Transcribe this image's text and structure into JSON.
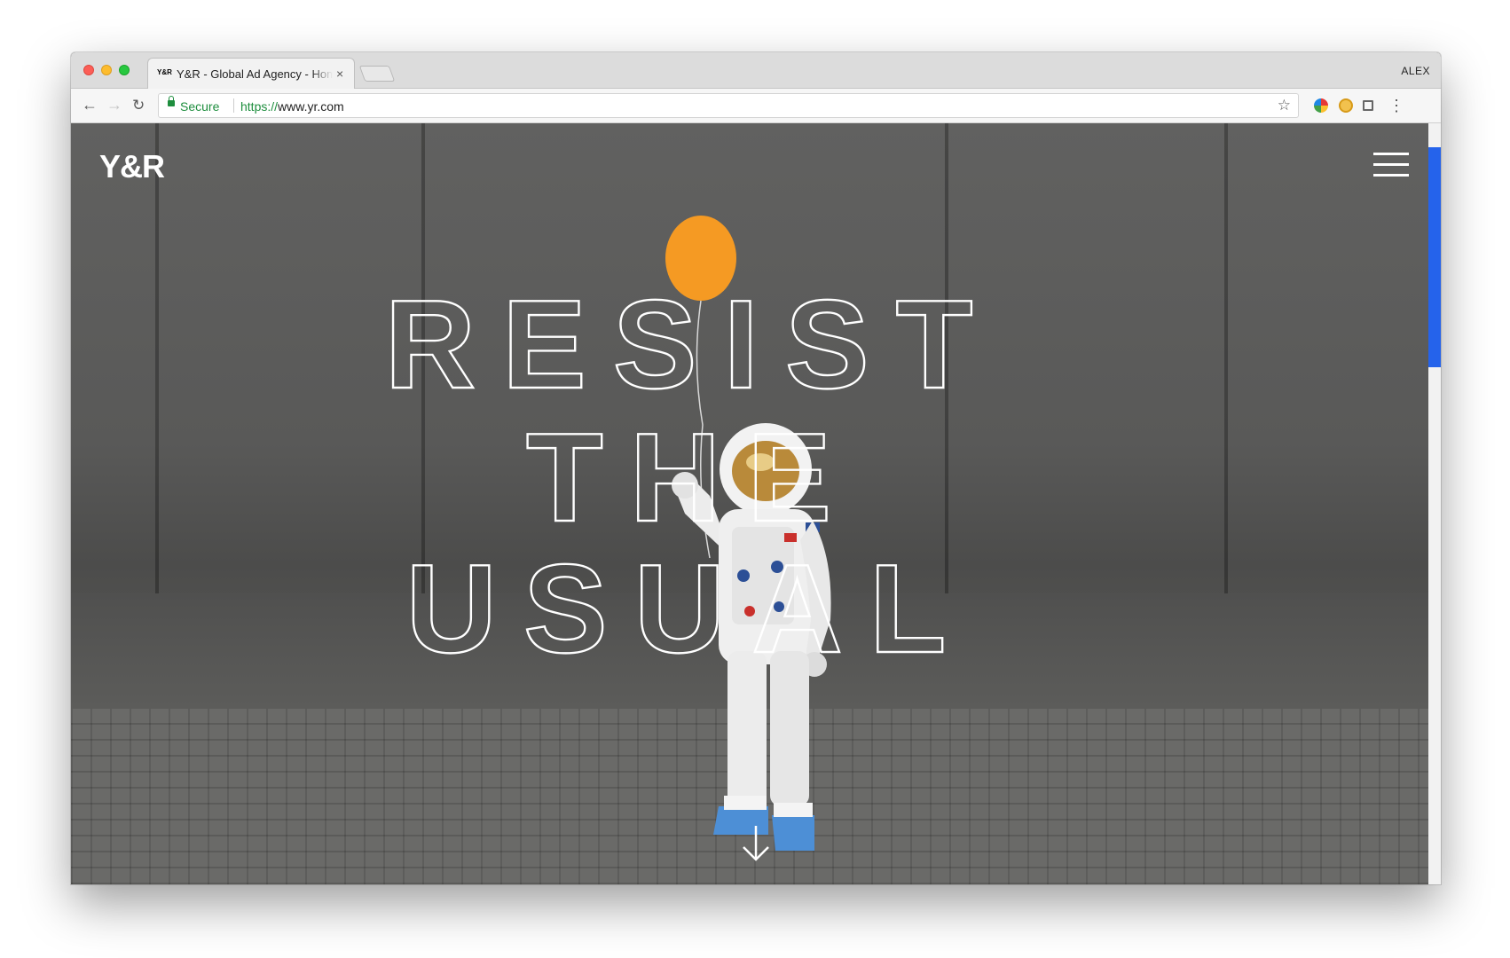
{
  "browser": {
    "tab": {
      "favicon_text": "Y&R",
      "title": "Y&R - Global Ad Agency - Home",
      "close_symbol": "×"
    },
    "profile_name": "ALEX",
    "toolbar": {
      "back_symbol": "←",
      "forward_symbol": "→",
      "reload_symbol": "↻",
      "secure_label": "Secure",
      "url_scheme": "https://",
      "url_host": "www.yr.com",
      "bookmark_symbol": "☆",
      "menu_symbol": "⋮"
    },
    "extensions": [
      "color-wheel-icon",
      "cat-icon",
      "screenshot-icon"
    ]
  },
  "site": {
    "logo": "Y&R",
    "headline_lines": [
      "RESIST",
      "THE",
      "USUAL"
    ],
    "scroll_position": 0.0,
    "colors": {
      "balloon": "#f59a23",
      "scrollbar_thumb": "#2563eb",
      "headline_outline": "#ffffff"
    }
  }
}
